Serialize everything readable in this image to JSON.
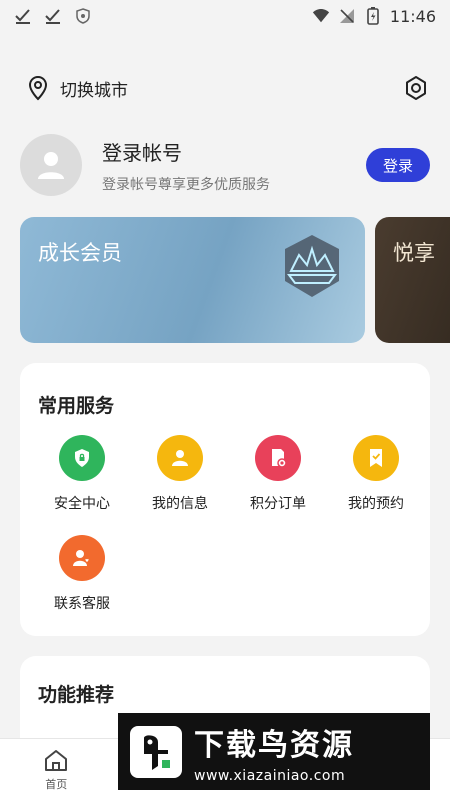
{
  "status_bar": {
    "time": "11:46",
    "icons": [
      "check-icon",
      "check-icon",
      "shield-icon",
      "wifi-icon",
      "no-signal-icon",
      "battery-icon"
    ]
  },
  "header": {
    "city_label": "切换城市",
    "location_icon": "location-pin-icon",
    "settings_icon": "settings-icon"
  },
  "login": {
    "title": "登录帐号",
    "subtitle": "登录帐号尊享更多优质服务",
    "button": "登录"
  },
  "member_cards": [
    {
      "title": "成长会员"
    },
    {
      "title": "悦享"
    }
  ],
  "services": {
    "title": "常用服务",
    "items": [
      {
        "label": "安全中心",
        "icon": "shield-icon",
        "color": "#2fb55c"
      },
      {
        "label": "我的信息",
        "icon": "person-icon",
        "color": "#f5b70e"
      },
      {
        "label": "积分订单",
        "icon": "order-icon",
        "color": "#e8415a"
      },
      {
        "label": "我的预约",
        "icon": "bookmark-check-icon",
        "color": "#f5b70e"
      },
      {
        "label": "联系客服",
        "icon": "support-icon",
        "color": "#f26a2e"
      }
    ]
  },
  "recommend": {
    "title": "功能推荐"
  },
  "bottom_nav": {
    "items": [
      {
        "label": "首页",
        "icon": "home-icon"
      },
      {
        "label": "",
        "icon": "vip-icon"
      },
      {
        "label": "",
        "icon": "points-icon"
      },
      {
        "label": "",
        "icon": "profile-icon"
      }
    ]
  },
  "watermark": {
    "title": "下载鸟资源",
    "url": "www.xiazainiao.com"
  }
}
